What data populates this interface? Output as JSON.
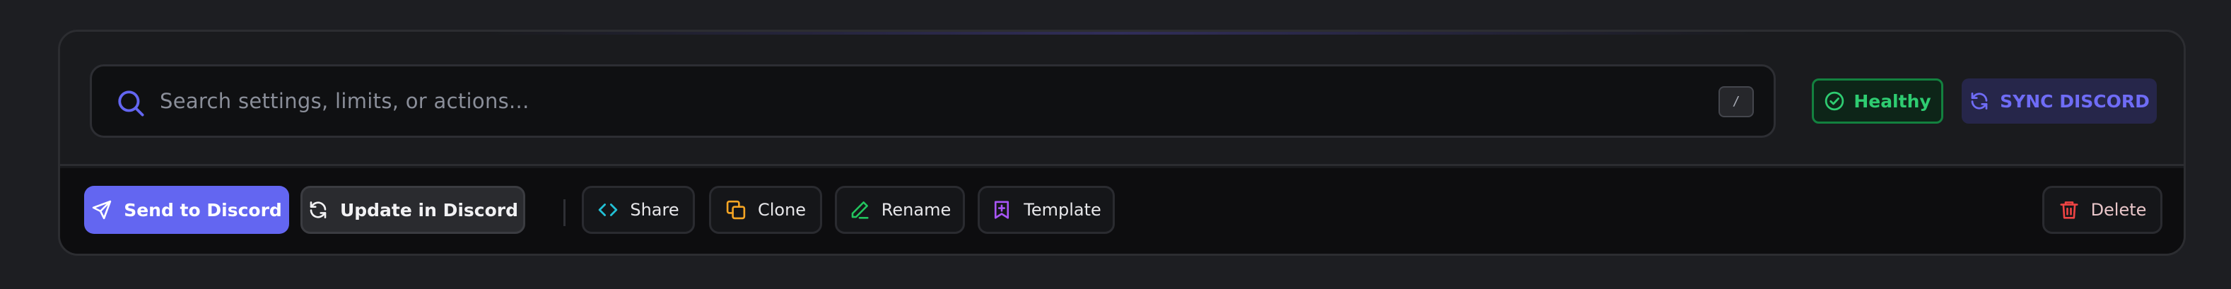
{
  "search": {
    "placeholder": "Search settings, limits, or actions...",
    "shortcut": "/"
  },
  "status": {
    "healthy_label": "Healthy",
    "healthy_color": "#2ecc71",
    "sync_label": "SYNC DISCORD",
    "sync_color": "#6f6cf6"
  },
  "actions": {
    "send_label": "Send to Discord",
    "update_label": "Update in Discord",
    "share_label": "Share",
    "clone_label": "Clone",
    "rename_label": "Rename",
    "template_label": "Template",
    "delete_label": "Delete"
  },
  "icons": {
    "search": "search-icon",
    "healthy": "check-circle-icon",
    "sync": "refresh-icon",
    "send": "paper-plane-icon",
    "update": "refresh-icon",
    "share": "code-brackets-icon",
    "clone": "copy-icon",
    "rename": "pencil-icon",
    "template": "bookmark-plus-icon",
    "delete": "trash-icon"
  },
  "colors": {
    "primary": "#6366f1",
    "share_icon": "#22c1d6",
    "clone_icon": "#f5a524",
    "rename_icon": "#22c55e",
    "template_icon": "#a855f7",
    "delete_icon": "#ef4444"
  }
}
